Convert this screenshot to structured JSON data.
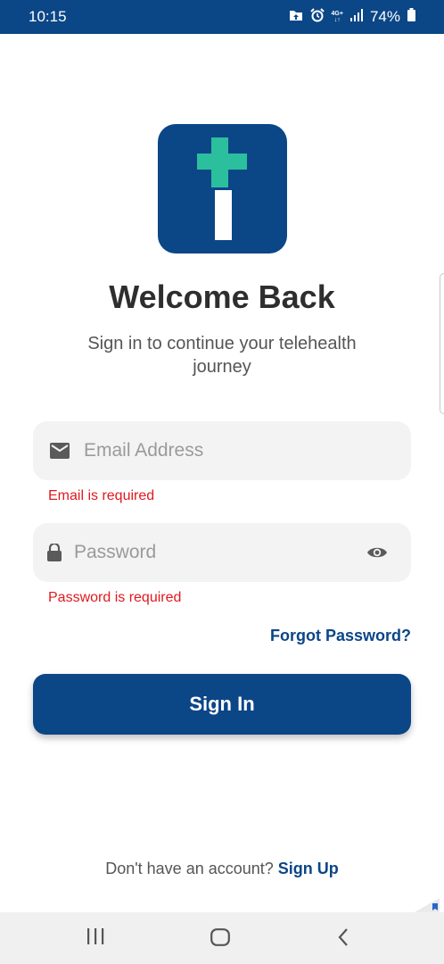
{
  "status_bar": {
    "time": "10:15",
    "network_top": "4G+",
    "network_bottom": "↓↑",
    "battery": "74%",
    "icons": [
      "folder-upload-icon",
      "alarm-icon",
      "network-4g-icon",
      "signal-icon",
      "battery-icon"
    ]
  },
  "logo": {
    "icon": "medical-cross-logo-icon",
    "colors": {
      "background": "#0b4687",
      "cross": "#2bbf9e",
      "bar": "#ffffff"
    }
  },
  "header": {
    "title": "Welcome Back",
    "subtitle": "Sign in to continue your telehealth journey"
  },
  "form": {
    "email": {
      "placeholder": "Email Address",
      "value": "",
      "icon": "mail-icon",
      "error": "Email is required"
    },
    "password": {
      "placeholder": "Password",
      "value": "",
      "icon": "lock-icon",
      "toggle_icon": "eye-icon",
      "error": "Password is required"
    },
    "forgot_password": "Forgot Password?",
    "submit_label": "Sign In"
  },
  "footer": {
    "prompt": "Don't have an account?",
    "signup_label": "Sign Up"
  },
  "nav_bar": {
    "icons": [
      "recents-icon",
      "home-icon",
      "back-icon"
    ]
  },
  "colors": {
    "primary": "#0b4687",
    "accent": "#2bbf9e",
    "error": "#e0191f",
    "field_background": "#f3f3f3"
  }
}
